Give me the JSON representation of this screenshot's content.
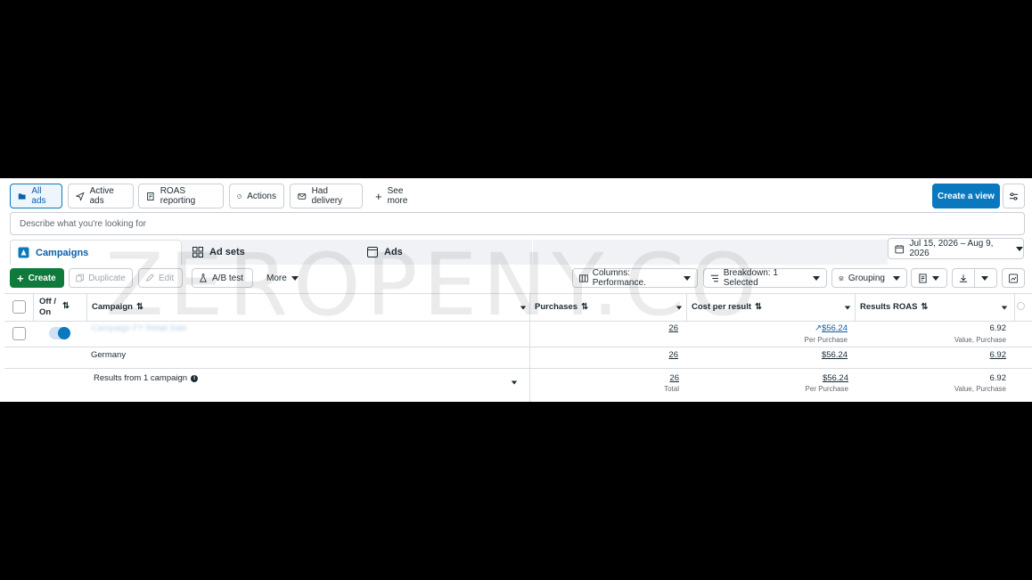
{
  "views": {
    "items": [
      {
        "label": "All ads",
        "icon": "folder-icon",
        "active": true
      },
      {
        "label": "Active ads",
        "icon": "send-icon"
      },
      {
        "label": "ROAS reporting",
        "icon": "report-icon"
      },
      {
        "label": "Actions",
        "icon": "gauge-icon"
      },
      {
        "label": "Had delivery",
        "icon": "envelope-icon"
      }
    ],
    "see_more": "See more",
    "create_view": "Create a view"
  },
  "search": {
    "placeholder": "Describe what you're looking for"
  },
  "levels": {
    "campaigns": "Campaigns",
    "ad_sets": "Ad sets",
    "ads": "Ads"
  },
  "date_range": "Jul 15, 2026 – Aug 9, 2026",
  "toolbar": {
    "create": "Create",
    "duplicate": "Duplicate",
    "edit": "Edit",
    "ab_test": "A/B test",
    "more": "More",
    "columns": "Columns: Performance.",
    "breakdown": "Breakdown: 1 Selected",
    "grouping": "Grouping"
  },
  "table": {
    "headers": {
      "off_on": "Off / On",
      "campaign": "Campaign",
      "purchases": "Purchases",
      "cost_per_result": "Cost per result",
      "results_roas": "Results ROAS"
    },
    "row": {
      "campaign_name": "Campaign FY Retail Sale",
      "toggle_on": true,
      "purchases": "26",
      "cost_per_result": "$56.24",
      "cost_sub": "Per Purchase",
      "roas": "6.92",
      "roas_sub": "Value, Purchase"
    },
    "breakdown_row": {
      "label": "Germany",
      "purchases": "26",
      "cost_per_result": "$56.24",
      "roas": "6.92"
    },
    "summary": {
      "label": "Results from 1 campaign",
      "purchases": "26",
      "purchases_sub": "Total",
      "cost_per_result": "$56.24",
      "cost_sub": "Per Purchase",
      "roas": "6.92",
      "roas_sub": "Value, Purchase"
    }
  },
  "watermark": "ZEROPENY.CO",
  "colors": {
    "primary": "#0a78be",
    "create": "#0f7a3c",
    "link": "#0a5fa8"
  }
}
